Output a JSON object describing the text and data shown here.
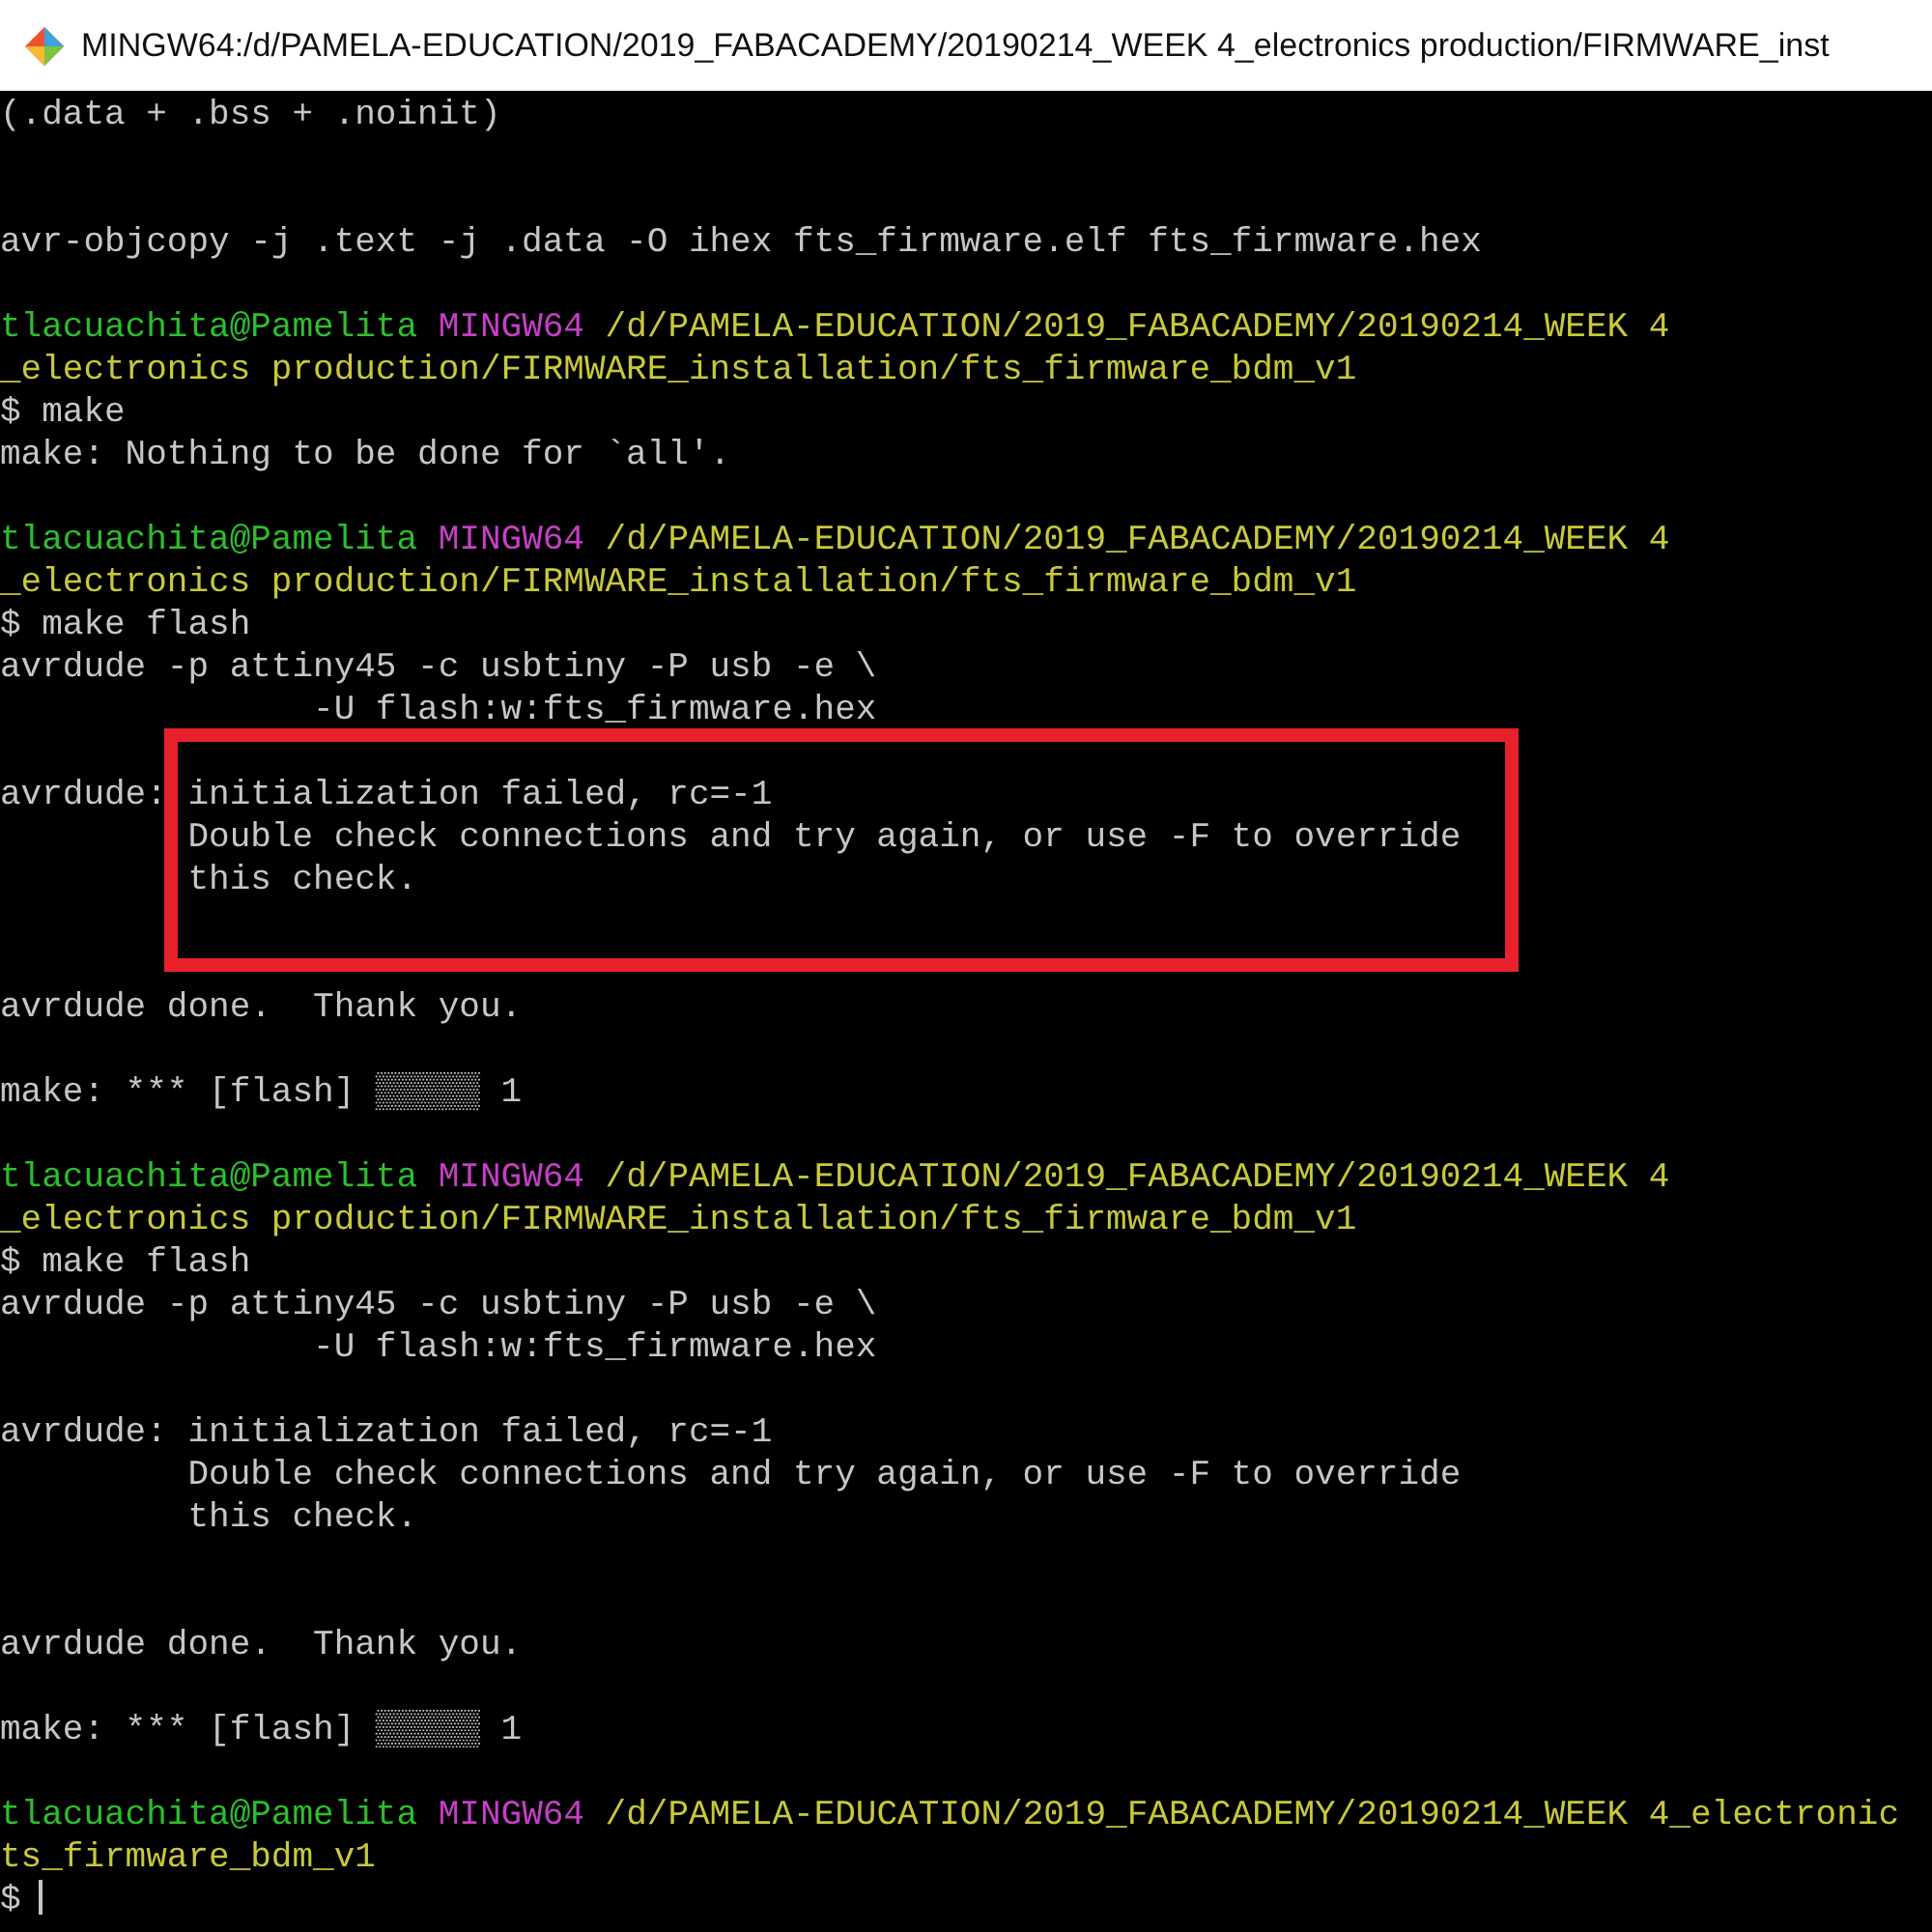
{
  "window": {
    "title": "MINGW64:/d/PAMELA-EDUCATION/2019_FABACADEMY/20190214_WEEK 4_electronics production/FIRMWARE_inst"
  },
  "lines": [
    {
      "kind": "text",
      "text": "(.data + .bss + .noinit)"
    },
    {
      "kind": "blank"
    },
    {
      "kind": "blank"
    },
    {
      "kind": "text",
      "text": "avr-objcopy -j .text -j .data -O ihex fts_firmware.elf fts_firmware.hex"
    },
    {
      "kind": "blank"
    },
    {
      "kind": "prompt",
      "user": "tlacuachita@Pamelita",
      "host": "MINGW64",
      "path": "/d/PAMELA-EDUCATION/2019_FABACADEMY/20190214_WEEK 4"
    },
    {
      "kind": "path",
      "text": "_electronics production/FIRMWARE_installation/fts_firmware_bdm_v1"
    },
    {
      "kind": "text",
      "text": "$ make"
    },
    {
      "kind": "text",
      "text": "make: Nothing to be done for `all'."
    },
    {
      "kind": "blank"
    },
    {
      "kind": "prompt",
      "user": "tlacuachita@Pamelita",
      "host": "MINGW64",
      "path": "/d/PAMELA-EDUCATION/2019_FABACADEMY/20190214_WEEK 4"
    },
    {
      "kind": "path",
      "text": "_electronics production/FIRMWARE_installation/fts_firmware_bdm_v1"
    },
    {
      "kind": "text",
      "text": "$ make flash"
    },
    {
      "kind": "text",
      "text": "avrdude -p attiny45 -c usbtiny -P usb -e \\"
    },
    {
      "kind": "text",
      "text": "               -U flash:w:fts_firmware.hex"
    },
    {
      "kind": "blank"
    },
    {
      "kind": "text",
      "text": "avrdude: initialization failed, rc=-1"
    },
    {
      "kind": "text",
      "text": "         Double check connections and try again, or use -F to override"
    },
    {
      "kind": "text",
      "text": "         this check."
    },
    {
      "kind": "blank"
    },
    {
      "kind": "blank"
    },
    {
      "kind": "text",
      "text": "avrdude done.  Thank you."
    },
    {
      "kind": "blank"
    },
    {
      "kind": "text",
      "text": "make: *** [flash] ▒▒▒▒▒ 1"
    },
    {
      "kind": "blank"
    },
    {
      "kind": "prompt",
      "user": "tlacuachita@Pamelita",
      "host": "MINGW64",
      "path": "/d/PAMELA-EDUCATION/2019_FABACADEMY/20190214_WEEK 4"
    },
    {
      "kind": "path",
      "text": "_electronics production/FIRMWARE_installation/fts_firmware_bdm_v1"
    },
    {
      "kind": "text",
      "text": "$ make flash"
    },
    {
      "kind": "text",
      "text": "avrdude -p attiny45 -c usbtiny -P usb -e \\"
    },
    {
      "kind": "text",
      "text": "               -U flash:w:fts_firmware.hex"
    },
    {
      "kind": "blank"
    },
    {
      "kind": "text",
      "text": "avrdude: initialization failed, rc=-1"
    },
    {
      "kind": "text",
      "text": "         Double check connections and try again, or use -F to override"
    },
    {
      "kind": "text",
      "text": "         this check."
    },
    {
      "kind": "blank"
    },
    {
      "kind": "blank"
    },
    {
      "kind": "text",
      "text": "avrdude done.  Thank you."
    },
    {
      "kind": "blank"
    },
    {
      "kind": "text",
      "text": "make: *** [flash] ▒▒▒▒▒ 1"
    },
    {
      "kind": "blank"
    },
    {
      "kind": "prompt",
      "user": "tlacuachita@Pamelita",
      "host": "MINGW64",
      "path": "/d/PAMELA-EDUCATION/2019_FABACADEMY/20190214_WEEK 4_electronic"
    },
    {
      "kind": "path",
      "text": "ts_firmware_bdm_v1"
    },
    {
      "kind": "input",
      "text": "$"
    }
  ]
}
